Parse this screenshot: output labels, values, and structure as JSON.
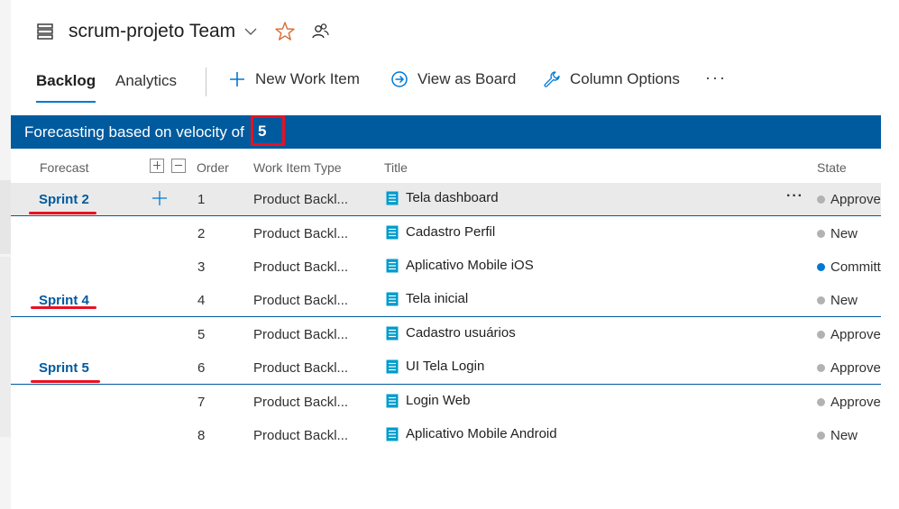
{
  "header": {
    "team_name": "scrum-projeto Team"
  },
  "tabs": [
    {
      "label": "Backlog"
    },
    {
      "label": "Analytics"
    }
  ],
  "commands": {
    "new_work_item": "New Work Item",
    "view_as_board": "View as Board",
    "column_options": "Column Options",
    "more": "···"
  },
  "forecast": {
    "text": "Forecasting based on velocity of",
    "velocity": "5"
  },
  "columns": {
    "forecast": "Forecast",
    "order": "Order",
    "work_item_type": "Work Item Type",
    "title": "Title",
    "state": "State"
  },
  "rows": [
    {
      "sprint": "Sprint 2",
      "order": "1",
      "type": "Product Backl...",
      "title": "Tela dashboard",
      "state": "Approved",
      "state_color": "#b2b2b2"
    },
    {
      "sprint": "",
      "order": "2",
      "type": "Product Backl...",
      "title": "Cadastro Perfil",
      "state": "New",
      "state_color": "#b2b2b2"
    },
    {
      "sprint": "",
      "order": "3",
      "type": "Product Backl...",
      "title": "Aplicativo Mobile iOS",
      "state": "Committed",
      "state_color": "#0078d4"
    },
    {
      "sprint": "Sprint 4",
      "order": "4",
      "type": "Product Backl...",
      "title": "Tela inicial",
      "state": "New",
      "state_color": "#b2b2b2"
    },
    {
      "sprint": "",
      "order": "5",
      "type": "Product Backl...",
      "title": "Cadastro usuários",
      "state": "Approved",
      "state_color": "#b2b2b2"
    },
    {
      "sprint": "Sprint 5",
      "order": "6",
      "type": "Product Backl...",
      "title": "UI Tela Login",
      "state": "Approved",
      "state_color": "#b2b2b2"
    },
    {
      "sprint": "",
      "order": "7",
      "type": "Product Backl...",
      "title": "Login Web",
      "state": "Approved",
      "state_color": "#b2b2b2"
    },
    {
      "sprint": "",
      "order": "8",
      "type": "Product Backl...",
      "title": "Aplicativo Mobile Android",
      "state": "New",
      "state_color": "#b2b2b2"
    }
  ],
  "colors": {
    "accent": "#0078d4",
    "forecast_bar": "#005a9e",
    "annotation_red": "#e81123",
    "work_item_icon": "#009ccc"
  },
  "icons": {
    "team": "backlog-board-icon",
    "chevron": "chevron-down-icon",
    "favorite": "star-icon",
    "members": "people-icon",
    "new": "plus-icon",
    "board": "arrow-circle-icon",
    "options": "wrench-icon",
    "work_item": "product-backlog-item-icon"
  }
}
